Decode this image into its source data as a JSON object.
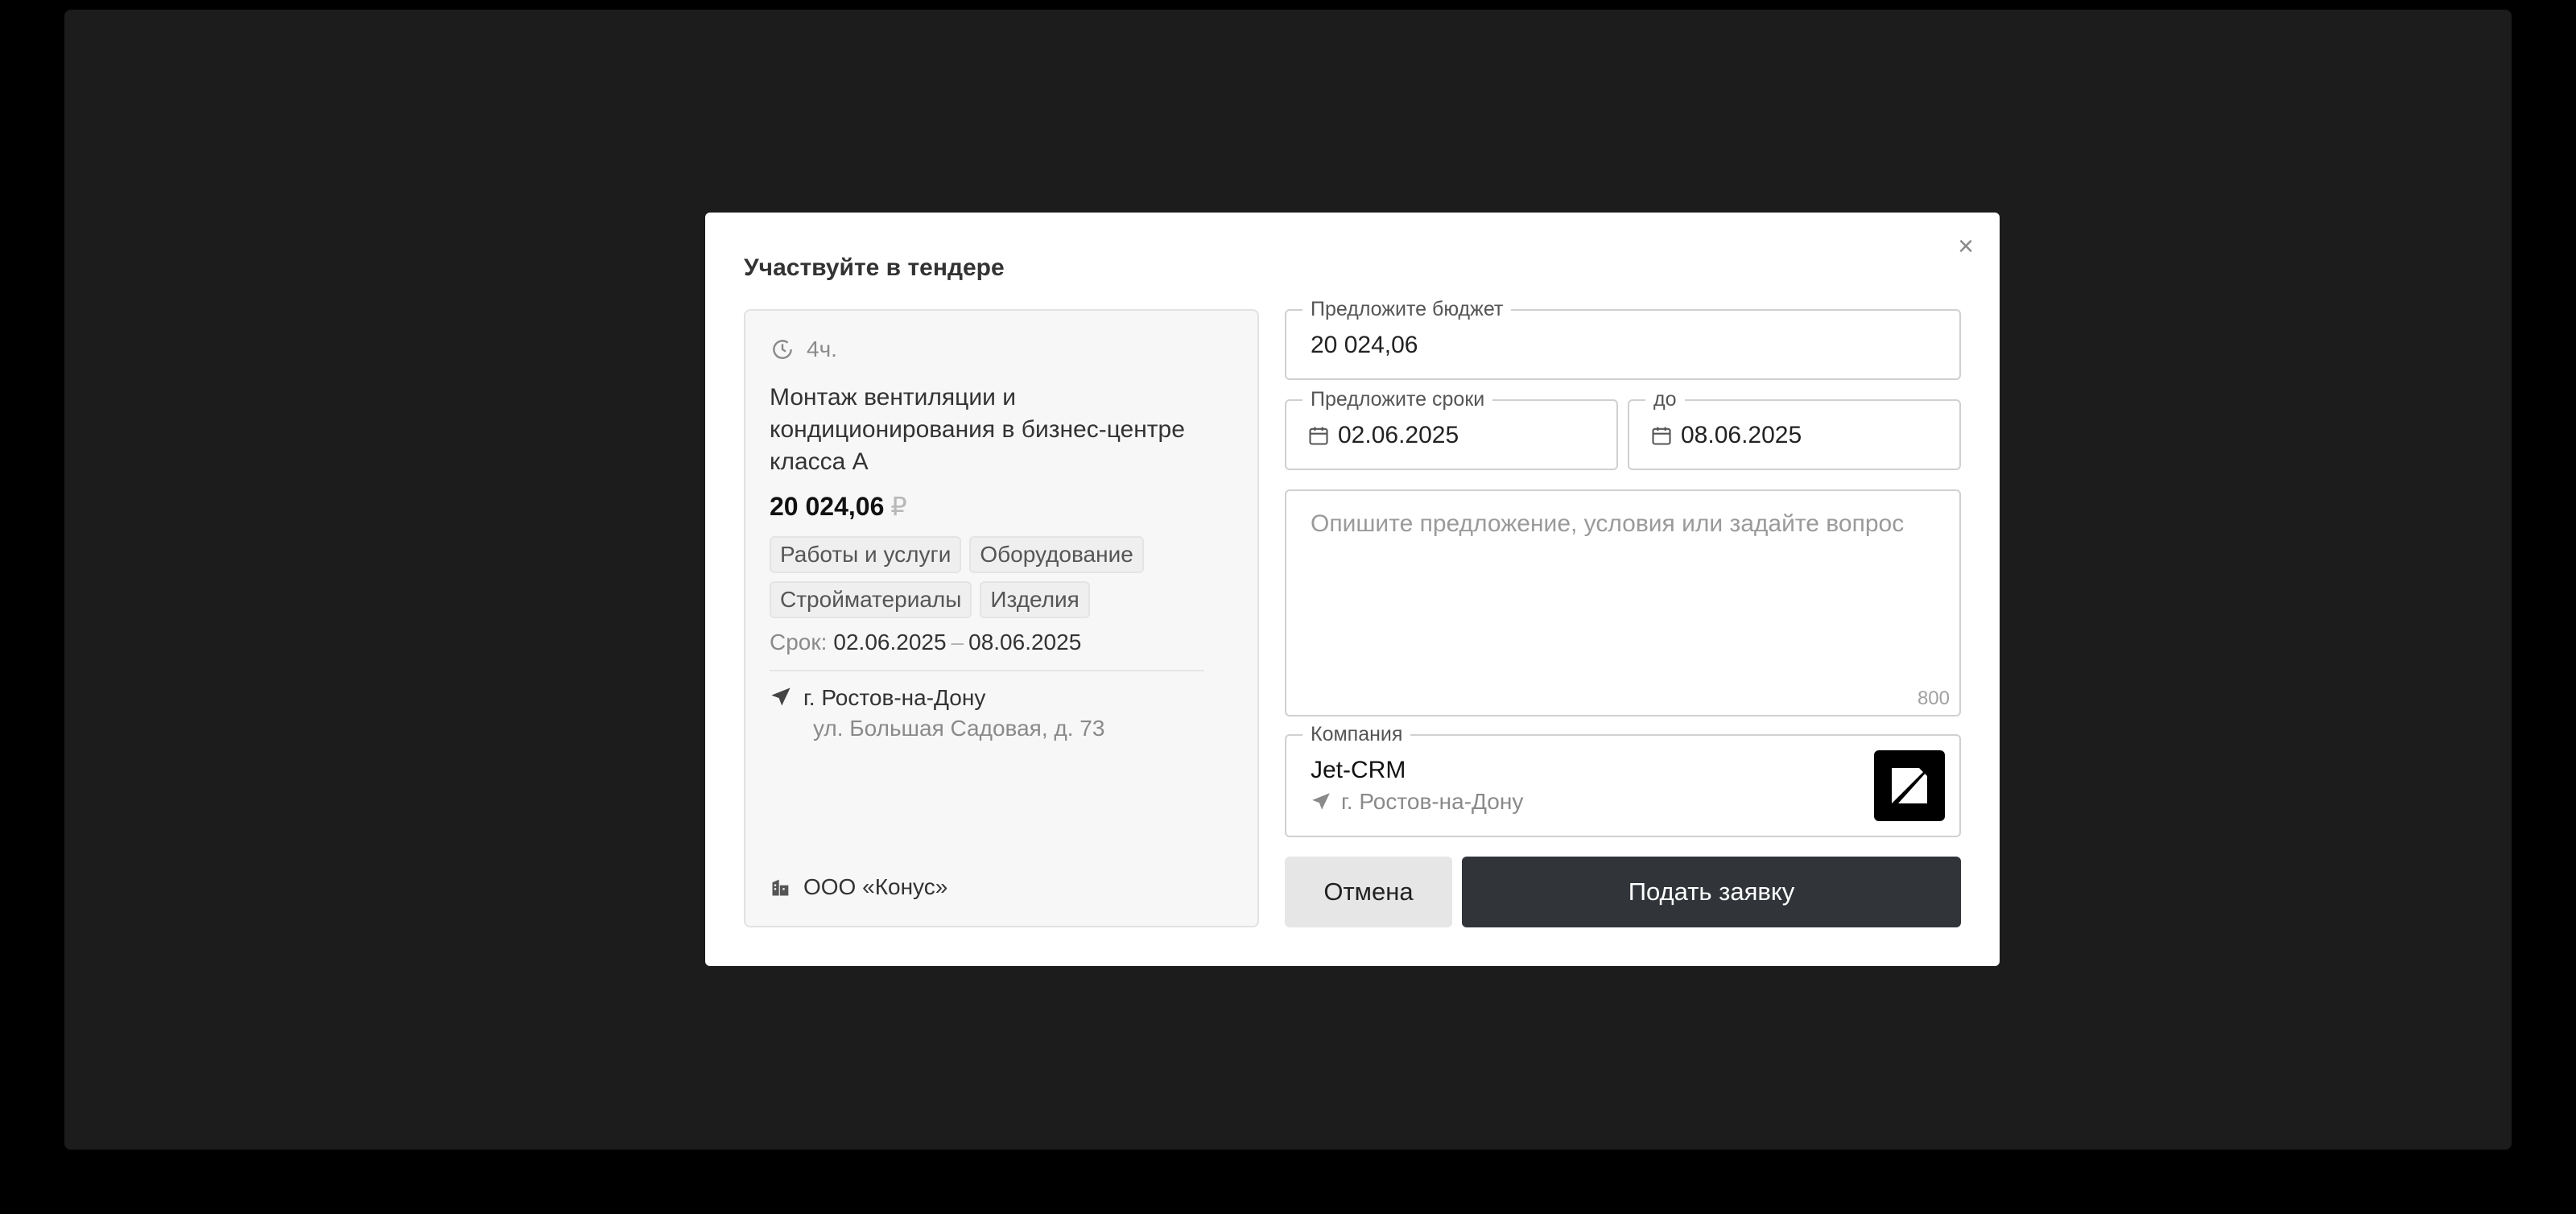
{
  "modal": {
    "title": "Участвуйте в тендере",
    "close_icon": "close-icon"
  },
  "tender": {
    "time_left": "4ч.",
    "title": "Монтаж вентиляции и кондиционирования в бизнес-центре класса А",
    "price": "20 024,06",
    "currency": "₽",
    "tags": [
      "Работы и услуги",
      "Оборудование",
      "Стройматериалы",
      "Изделия"
    ],
    "deadline_label": "Срок:",
    "deadline_from": "02.06.2025",
    "deadline_dash": "–",
    "deadline_to": "08.06.2025",
    "city": "г. Ростов-на-Дону",
    "street": "ул. Большая Садовая, д. 73",
    "organization": "ООО «Конус»"
  },
  "form": {
    "budget_label": "Предложите бюджет",
    "budget_value": "20 024,06",
    "dates_label": "Предложите сроки",
    "date_from": "02.06.2025",
    "date_to_label": "до",
    "date_to": "08.06.2025",
    "message_placeholder": "Опишите предложение, условия или задайте вопрос",
    "message_counter": "800",
    "company_label": "Компания",
    "company_name": "Jet-CRM",
    "company_city": "г. Ростов-на-Дону",
    "cancel_label": "Отмена",
    "submit_label": "Подать заявку"
  },
  "colors": {
    "submit_bg": "#31353a",
    "cancel_bg": "#e6e6e6",
    "backdrop": "#1c1c1c"
  }
}
